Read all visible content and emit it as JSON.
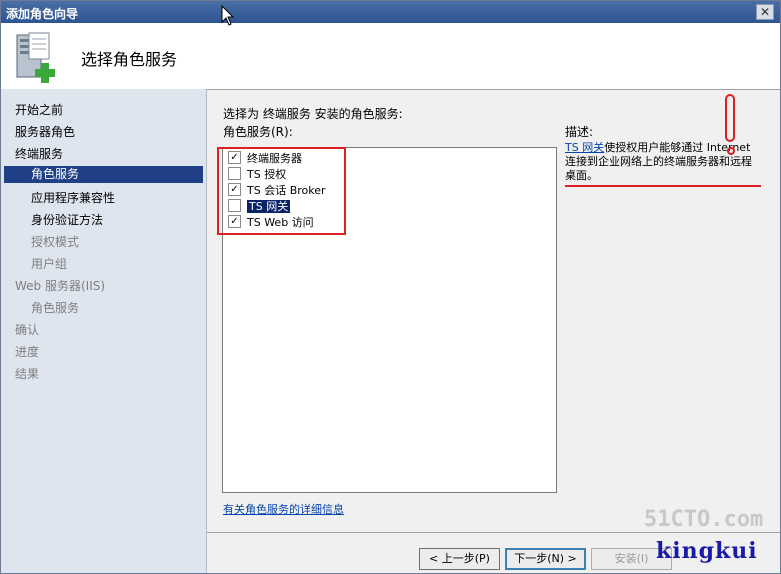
{
  "window": {
    "title": "添加角色向导",
    "close_glyph": "✕"
  },
  "header": {
    "heading": "选择角色服务"
  },
  "nav": {
    "items": [
      {
        "label": "开始之前"
      },
      {
        "label": "服务器角色"
      },
      {
        "label": "终端服务"
      },
      {
        "label": "角色服务"
      },
      {
        "label": "应用程序兼容性"
      },
      {
        "label": "身份验证方法"
      },
      {
        "label": "授权模式"
      },
      {
        "label": "用户组"
      },
      {
        "label": "Web 服务器(IIS)"
      },
      {
        "label": "角色服务"
      },
      {
        "label": "确认"
      },
      {
        "label": "进度"
      },
      {
        "label": "结果"
      }
    ]
  },
  "main": {
    "instruction": "选择为 终端服务 安装的角色服务:",
    "list_label": "角色服务(R):",
    "services": [
      {
        "label": "终端服务器",
        "checked": true
      },
      {
        "label": "TS 授权",
        "checked": false
      },
      {
        "label": "TS 会话 Broker",
        "checked": true
      },
      {
        "label": "TS 网关",
        "checked": false
      },
      {
        "label": "TS Web 访问",
        "checked": true
      }
    ],
    "description_heading": "描述:",
    "description_link": "TS 网关",
    "description_text": "使授权用户能够通过 Internet 连接到企业网络上的终端服务器和远程桌面。",
    "more_info_link": "有关角色服务的详细信息"
  },
  "buttons": {
    "back": "< 上一步(P)",
    "next": "下一步(N) >",
    "install": "安装(I)"
  },
  "watermark": {
    "site": "51CTO.com",
    "author": "kingkui"
  },
  "colors": {
    "accent": "#1f3f87",
    "annotation": "#e02020"
  },
  "icons": {
    "header": "server-add-icon"
  }
}
